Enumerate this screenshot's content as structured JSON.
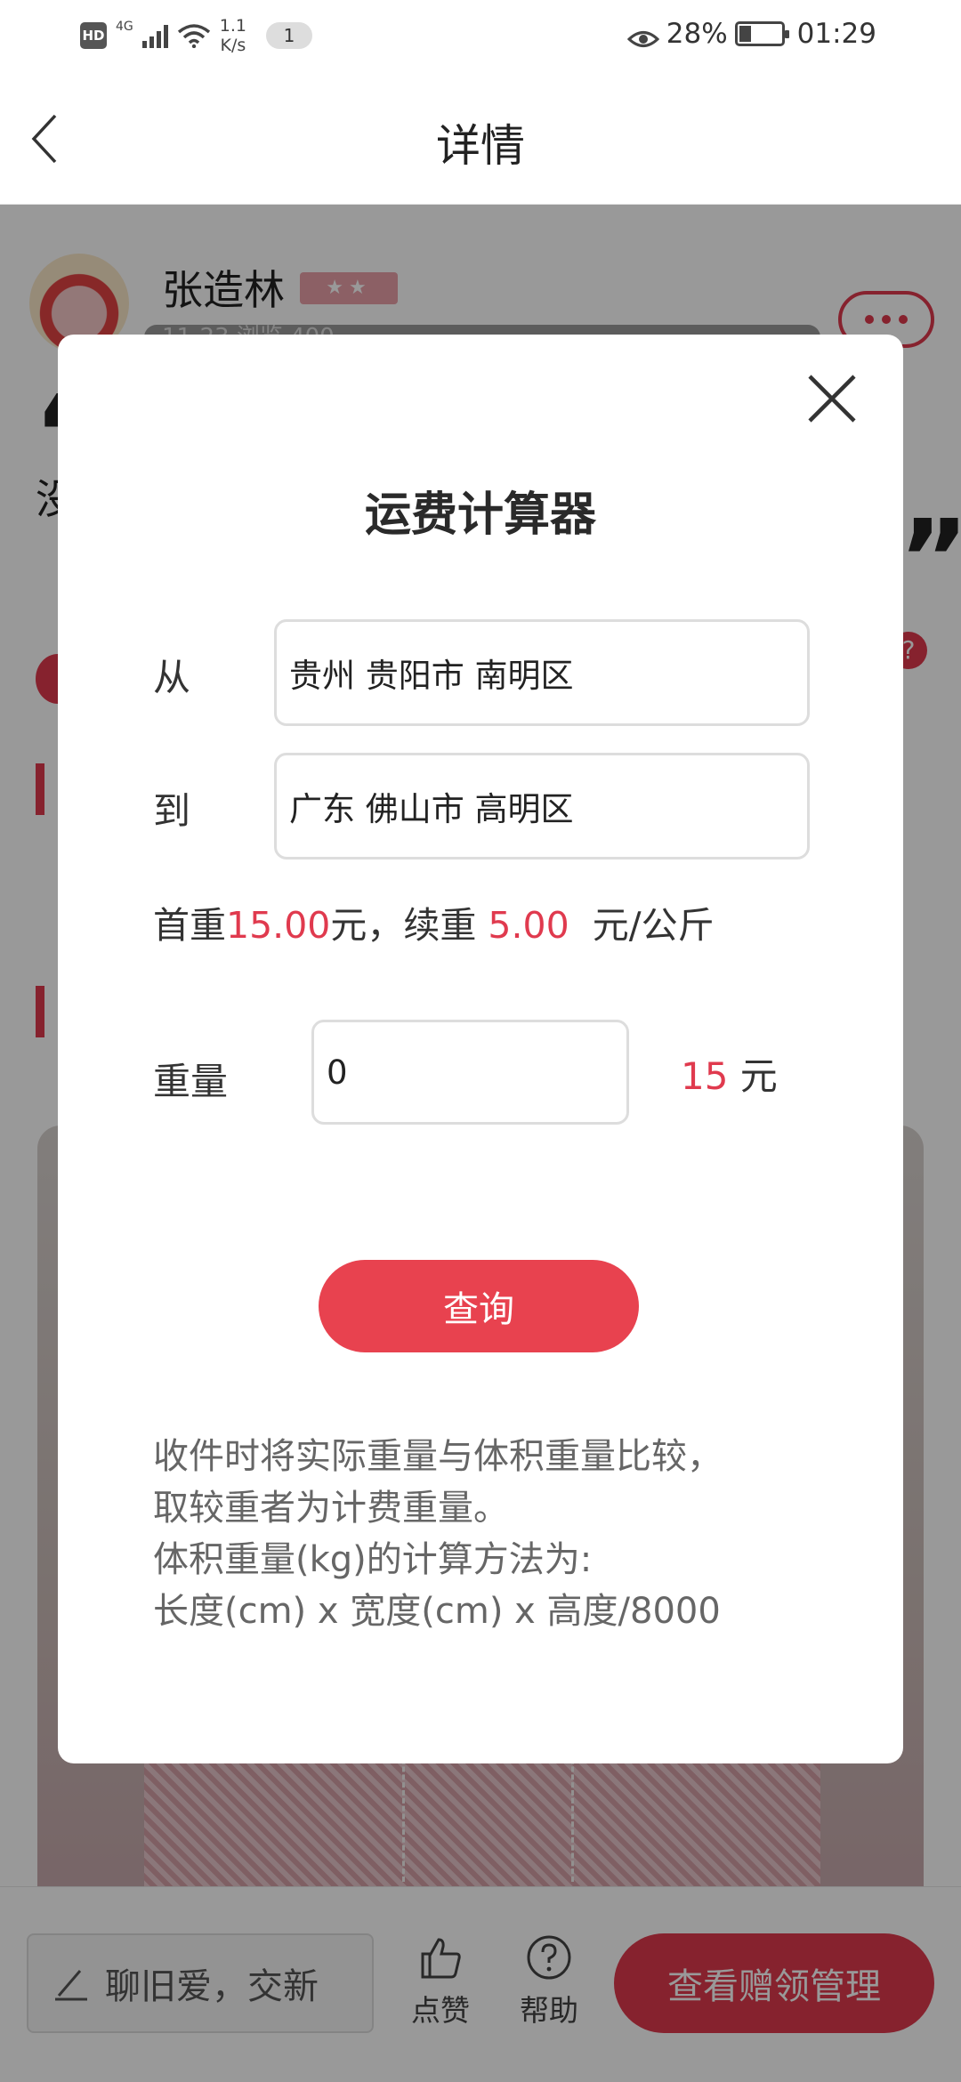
{
  "status_bar": {
    "hd": "HD",
    "network": "4G",
    "speed_value": "1.1",
    "speed_unit": "K/s",
    "notification_count": "1",
    "battery_percent": "28%",
    "battery_level": 0.28,
    "time": "01:29"
  },
  "header": {
    "title": "详情"
  },
  "post": {
    "author": "张造林",
    "level_badge": "★★",
    "meta": "11-23 浏览 400",
    "quote_open": "“",
    "quote_close": "”",
    "partial_char": "没",
    "help_mark": "?"
  },
  "modal": {
    "title": "运费计算器",
    "from_label": "从",
    "from_value": "贵州 贵阳市 南明区",
    "to_label": "到",
    "to_value": "广东 佛山市 高明区",
    "rate": {
      "first_weight_label": "首重",
      "first_weight_value": "15.00",
      "first_weight_unit": "元，续重 ",
      "extra_weight_value": "5.00",
      "extra_weight_unit": "  元/公斤"
    },
    "weight_label": "重量",
    "weight_value": "0",
    "cost_value": "15",
    "cost_unit": " 元",
    "query_button": "查询",
    "note_lines": [
      "收件时将实际重量与体积重量比较，",
      "取较重者为计费重量。",
      "体积重量(kg)的计算方法为:",
      "长度(cm) x 宽度(cm) x 高度/8000"
    ]
  },
  "bottom_bar": {
    "comment_placeholder": "聊旧爱，交新",
    "like_label": "点赞",
    "help_label": "帮助",
    "manage_button": "查看赠领管理"
  },
  "colors": {
    "accent": "#e03a4e",
    "overlay": "rgba(0,0,0,0.40)"
  }
}
